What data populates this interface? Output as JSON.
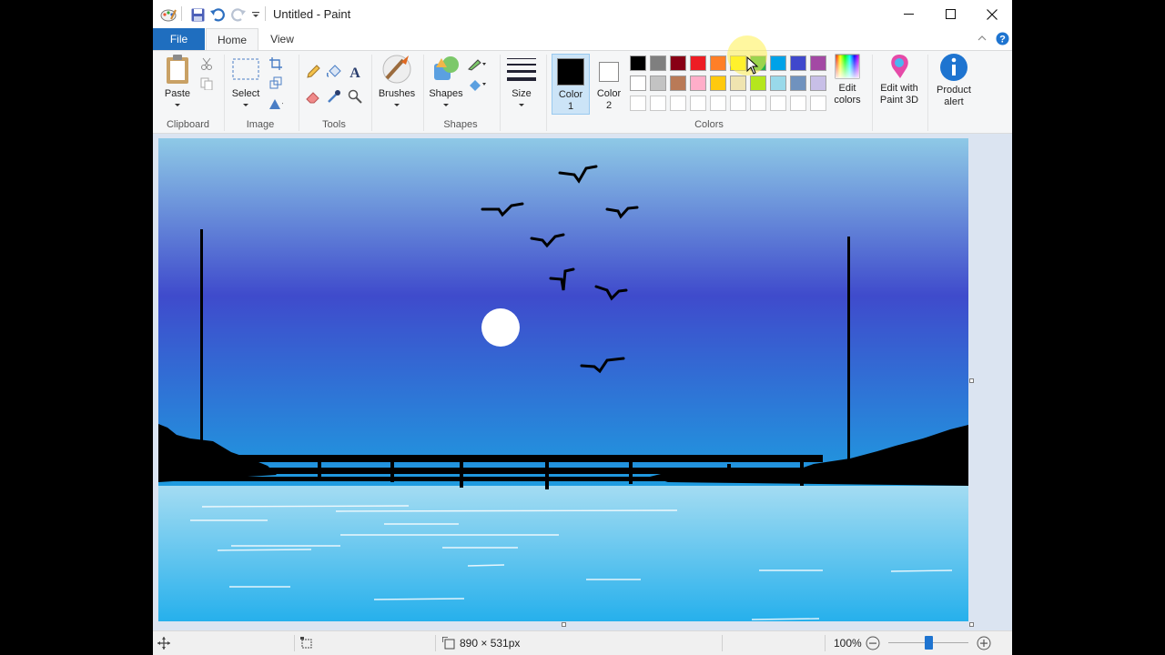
{
  "window": {
    "title": "Untitled - Paint",
    "controls": {
      "minimize": "minimize",
      "maximize": "maximize",
      "close": "close"
    }
  },
  "quick_access": {
    "icons": [
      "paint-app-icon",
      "save-icon",
      "undo-icon",
      "redo-icon",
      "customize-dropdown-icon"
    ]
  },
  "tabs": {
    "file": "File",
    "home": "Home",
    "view": "View"
  },
  "ribbon": {
    "clipboard": {
      "label": "Clipboard",
      "paste": "Paste"
    },
    "image": {
      "label": "Image",
      "select": "Select"
    },
    "tools": {
      "label": "Tools"
    },
    "brushes": {
      "label": "Brushes"
    },
    "shapes": {
      "label": "Shapes",
      "button": "Shapes"
    },
    "size": {
      "label": "Size"
    },
    "colors": {
      "label": "Colors",
      "color1": {
        "line1": "Color",
        "line2": "1",
        "value": "#000000"
      },
      "color2": {
        "line1": "Color",
        "line2": "2",
        "value": "#ffffff"
      },
      "palette_row1": [
        "#000000",
        "#7f7f7f",
        "#880015",
        "#ed1c24",
        "#ff7f27",
        "#fff200",
        "#22b14c",
        "#00a2e8",
        "#3f48cc",
        "#a349a4"
      ],
      "palette_row2": [
        "#ffffff",
        "#c3c3c3",
        "#b97a57",
        "#ffaec9",
        "#ffc90e",
        "#efe4b0",
        "#b5e61d",
        "#99d9ea",
        "#7092be",
        "#c8bfe7"
      ],
      "edit_colors": {
        "line1": "Edit",
        "line2": "colors"
      }
    },
    "paint3d": {
      "line1": "Edit with",
      "line2": "Paint 3D"
    },
    "product_alert": {
      "line1": "Product",
      "line2": "alert"
    }
  },
  "status": {
    "canvas_size": "890 × 531px",
    "zoom": "100%",
    "zoom_fraction": 0.5
  },
  "drawing": {
    "sky_top": "#8ec9e6",
    "sky_mid": "#3f4bcc",
    "sky_bottom": "#1e9de0",
    "water_top": "#a4dcf2",
    "water_bottom": "#26b0ec"
  }
}
